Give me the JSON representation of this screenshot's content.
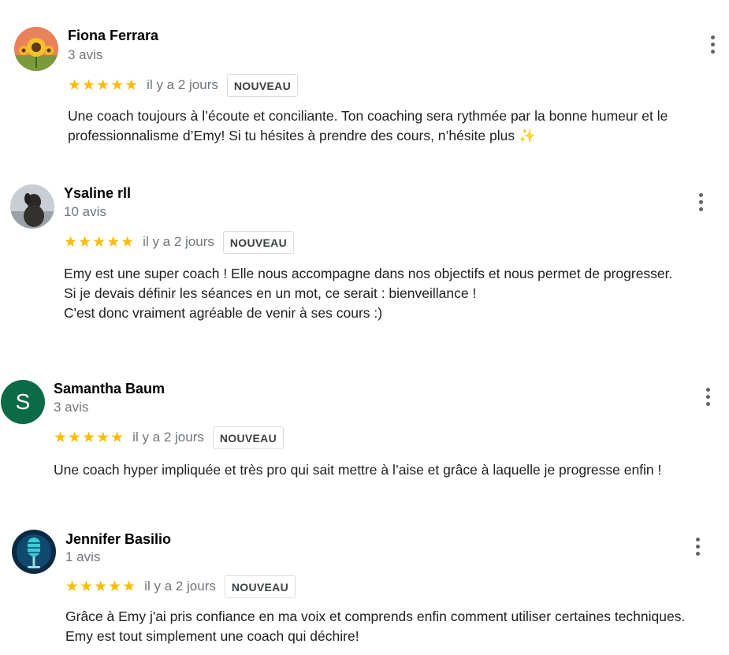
{
  "reviews": [
    {
      "name": "Fiona Ferrara",
      "count": "3 avis",
      "stars": "★★★★★",
      "rating": 5,
      "when": "il y a 2 jours",
      "badge": "NOUVEAU",
      "lines": [
        "Une coach toujours à l’écoute et conciliante. Ton coaching sera rythmée par la bonne humeur et le",
        "professionnalisme d’Emy! Si tu hésites à prendre des cours, n’hésite plus ✨"
      ],
      "avatar_icon": "sunflower-photo"
    },
    {
      "name": "Ysaline rll",
      "count": "10 avis",
      "stars": "★★★★★",
      "rating": 5,
      "when": "il y a 2 jours",
      "badge": "NOUVEAU",
      "lines": [
        "Emy est une super coach ! Elle nous accompagne dans nos objectifs et nous permet de progresser.",
        "Si je devais définir les séances en un mot, ce serait : bienveillance !",
        "C'est donc vraiment agréable de venir à ses cours :)"
      ],
      "avatar_icon": "dog-photo"
    },
    {
      "name": "Samantha Baum",
      "count": "3 avis",
      "stars": "★★★★★",
      "rating": 5,
      "when": "il y a 2 jours",
      "badge": "NOUVEAU",
      "lines": [
        "Une coach hyper impliquée et très pro qui sait mettre à l’aise et grâce à laquelle je progresse enfin !"
      ],
      "avatar_letter": "S",
      "avatar_color": "#0b6b47"
    },
    {
      "name": "Jennifer Basilio",
      "count": "1 avis",
      "stars": "★★★★★",
      "rating": 5,
      "when": "il y a 2 jours",
      "badge": "NOUVEAU",
      "lines": [
        "Grâce à Emy j'ai pris confiance en ma voix et comprends enfin comment utiliser certaines techniques.",
        "Emy est tout simplement une coach qui déchire!"
      ],
      "avatar_icon": "microphone-photo"
    }
  ],
  "colors": {
    "star": "#fbbc04",
    "muted": "#70757a",
    "text": "#202124"
  }
}
